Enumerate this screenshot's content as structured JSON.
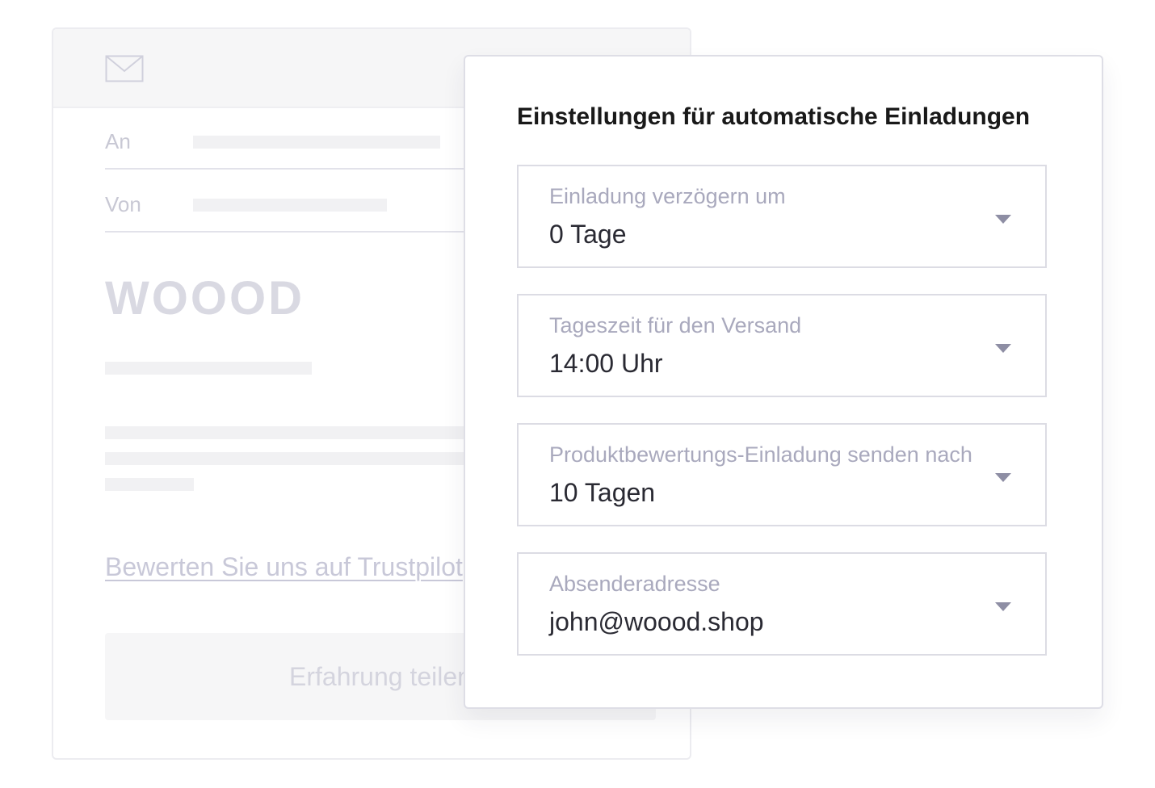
{
  "email_preview": {
    "to_label": "An",
    "from_label": "Von",
    "logo_text": "WOOOD",
    "trustpilot_link": "Bewerten Sie uns auf Trustpilot",
    "share_button": "Erfahrung teilen"
  },
  "settings": {
    "title": "Einstellungen für automatische Einladungen",
    "fields": [
      {
        "label": "Einladung verzögern um",
        "value": "0 Tage"
      },
      {
        "label": "Tageszeit für den Versand",
        "value": "14:00 Uhr"
      },
      {
        "label": "Produktbewertungs-Einladung senden nach",
        "value": "10 Tagen"
      },
      {
        "label": "Absenderadresse",
        "value": "john@woood.shop"
      }
    ]
  }
}
